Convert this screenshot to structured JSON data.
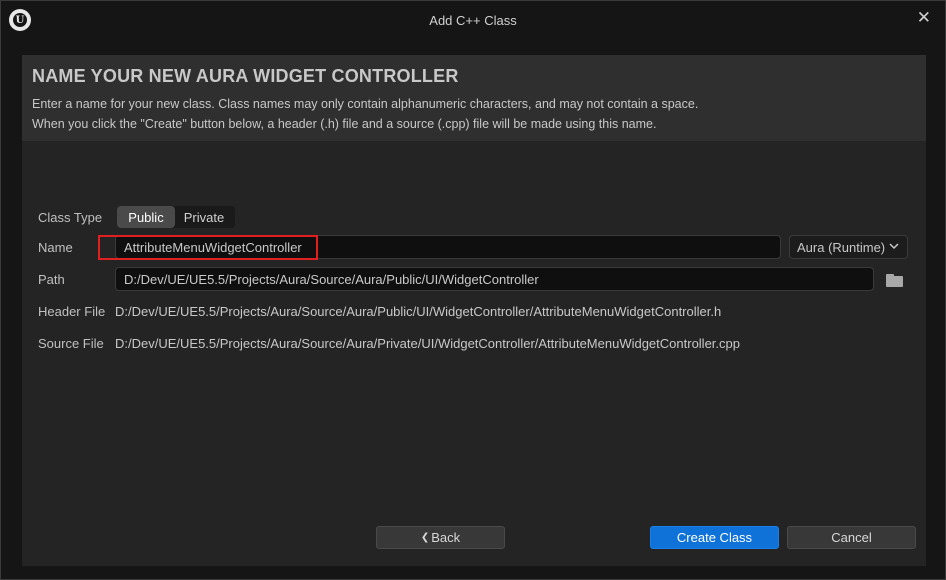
{
  "window": {
    "title": "Add C++ Class",
    "logo_text": "U",
    "close_glyph": "✕"
  },
  "header": {
    "heading": "NAME YOUR NEW AURA WIDGET CONTROLLER",
    "description_line1": "Enter a name for your new class. Class names may only contain alphanumeric characters, and may not contain a space.",
    "description_line2": "When you click the \"Create\" button below, a header (.h) file and a source (.cpp) file will be made using this name."
  },
  "form": {
    "class_type_label": "Class Type",
    "class_type_options": [
      "Public",
      "Private"
    ],
    "class_type_selected": "Public",
    "name_label": "Name",
    "name_value": "AttributeMenuWidgetController",
    "module_value": "Aura (Runtime)",
    "path_label": "Path",
    "path_value": "D:/Dev/UE/UE5.5/Projects/Aura/Source/Aura/Public/UI/WidgetController",
    "header_file_label": "Header File",
    "header_file_value": "D:/Dev/UE/UE5.5/Projects/Aura/Source/Aura/Public/UI/WidgetController/AttributeMenuWidgetController.h",
    "source_file_label": "Source File",
    "source_file_value": "D:/Dev/UE/UE5.5/Projects/Aura/Source/Aura/Private/UI/WidgetController/AttributeMenuWidgetController.cpp"
  },
  "footer": {
    "back_label": "Back",
    "back_glyph": "❮",
    "create_label": "Create Class",
    "cancel_label": "Cancel"
  },
  "icons": {
    "logo": "unreal-logo-icon",
    "close": "close-icon",
    "folder": "folder-icon",
    "dropdown": "chevron-down-icon",
    "back": "chevron-left-icon"
  },
  "colors": {
    "accent": "#0f72d8",
    "highlight_border": "#e02020"
  }
}
